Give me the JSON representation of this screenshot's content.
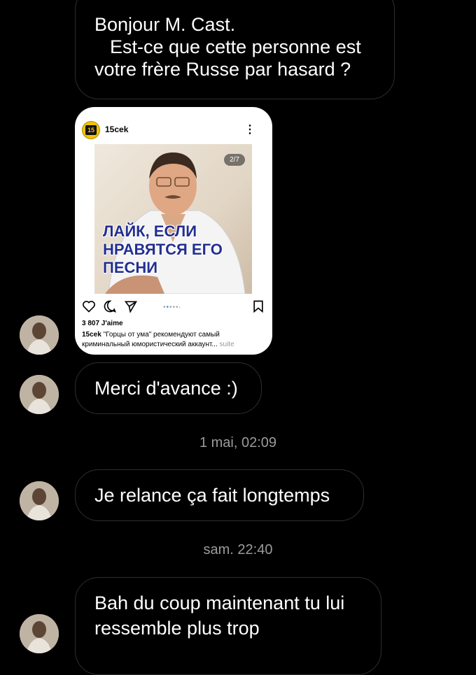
{
  "messages": {
    "m1": "Bonjour M. Cast.",
    "m1b": "Est-ce que cette personne est",
    "m1c": "votre frère Russe par hasard ?",
    "m2": "Merci d'avance :)",
    "m3": "Je relance ça fait longtemps",
    "m4a": "Bah du coup maintenant tu lui",
    "m4b": "ressemble plus trop"
  },
  "timestamps": {
    "t1": "1 mai, 02:09",
    "t2": "sam. 22:40"
  },
  "post": {
    "username": "15cek",
    "counter": "2/7",
    "overlay_text": "ЛАЙК, ЕСЛИ НРАВЯТСЯ ЕГО ПЕСНИ",
    "likes": "3 807 J'aime",
    "caption_user": "15cek",
    "caption_text": "\"Горцы от ума\" рекомендуют самый криминальный юмористический аккаунт...",
    "caption_more": "suite",
    "logo_text": "15"
  },
  "icons": {
    "like": "heart-icon",
    "comment": "comment-icon",
    "share": "send-icon",
    "save": "bookmark-icon",
    "more": "more-dots-icon"
  }
}
